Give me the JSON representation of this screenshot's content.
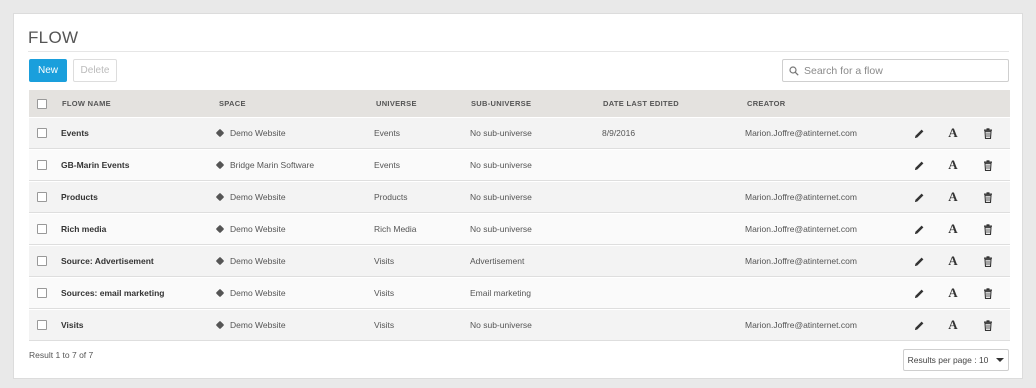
{
  "page": {
    "title": "FLOW"
  },
  "toolbar": {
    "new_label": "New",
    "delete_label": "Delete"
  },
  "search": {
    "placeholder": "Search for a flow"
  },
  "table": {
    "headers": {
      "flow_name": "FLOW NAME",
      "space": "SPACE",
      "universe": "UNIVERSE",
      "sub_universe": "SUB-UNIVERSE",
      "date_last_edited": "DATE LAST EDITED",
      "creator": "CREATOR"
    },
    "rows": [
      {
        "name": "Events",
        "space": "Demo Website",
        "universe": "Events",
        "sub_universe": "No sub-universe",
        "date": "8/9/2016",
        "creator": "Marion.Joffre@atinternet.com"
      },
      {
        "name": "GB-Marin Events",
        "space": "Bridge Marin Software",
        "universe": "Events",
        "sub_universe": "No sub-universe",
        "date": "",
        "creator": ""
      },
      {
        "name": "Products",
        "space": "Demo Website",
        "universe": "Products",
        "sub_universe": "No sub-universe",
        "date": "",
        "creator": "Marion.Joffre@atinternet.com"
      },
      {
        "name": "Rich media",
        "space": "Demo Website",
        "universe": "Rich Media",
        "sub_universe": "No sub-universe",
        "date": "",
        "creator": "Marion.Joffre@atinternet.com"
      },
      {
        "name": "Source: Advertisement",
        "space": "Demo Website",
        "universe": "Visits",
        "sub_universe": "Advertisement",
        "date": "",
        "creator": "Marion.Joffre@atinternet.com"
      },
      {
        "name": "Sources: email marketing",
        "space": "Demo Website",
        "universe": "Visits",
        "sub_universe": "Email marketing",
        "date": "",
        "creator": ""
      },
      {
        "name": "Visits",
        "space": "Demo Website",
        "universe": "Visits",
        "sub_universe": "No sub-universe",
        "date": "",
        "creator": "Marion.Joffre@atinternet.com"
      }
    ],
    "row_icons": {
      "edit": "pencil-icon",
      "font": "font-a-icon",
      "delete": "trash-icon",
      "space": "cube-icon"
    }
  },
  "footer": {
    "result_text": "Result 1 to 7 of 7",
    "per_page_label": "Results per page : 10"
  },
  "colors": {
    "accent": "#1a9fdc",
    "header_bg": "#e4e2df"
  }
}
